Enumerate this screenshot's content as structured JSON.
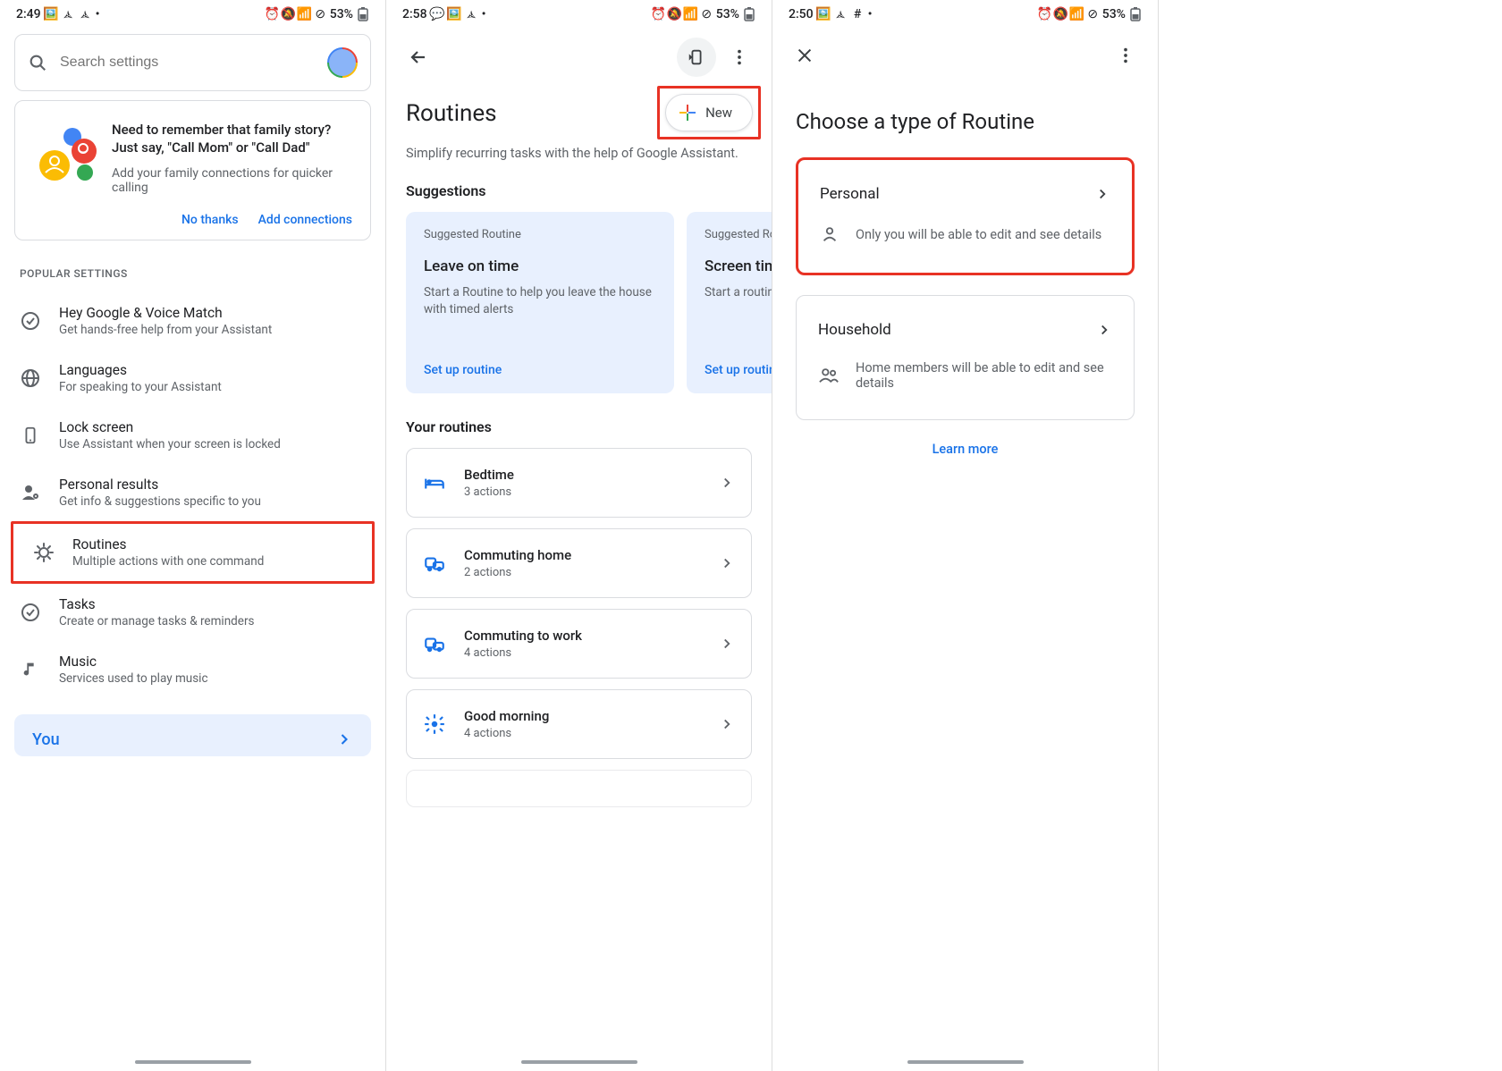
{
  "screen1": {
    "status": {
      "time": "2:49",
      "battery": "53%"
    },
    "search_placeholder": "Search settings",
    "promo": {
      "title": "Need to remember that family story? Just say, \"Call Mom\" or \"Call Dad\"",
      "sub": "Add your family connections for quicker calling",
      "no_thanks": "No thanks",
      "add": "Add connections"
    },
    "popular_label": "POPULAR SETTINGS",
    "items": [
      {
        "title": "Hey Google & Voice Match",
        "sub": "Get hands-free help from your Assistant"
      },
      {
        "title": "Languages",
        "sub": "For speaking to your Assistant"
      },
      {
        "title": "Lock screen",
        "sub": "Use Assistant when your screen is locked"
      },
      {
        "title": "Personal results",
        "sub": "Get info & suggestions specific to you"
      },
      {
        "title": "Routines",
        "sub": "Multiple actions with one command"
      },
      {
        "title": "Tasks",
        "sub": "Create or manage tasks & reminders"
      },
      {
        "title": "Music",
        "sub": "Services used to play music"
      }
    ],
    "you": "You"
  },
  "screen2": {
    "status": {
      "time": "2:58",
      "battery": "53%"
    },
    "title": "Routines",
    "new_label": "New",
    "subtitle": "Simplify recurring tasks with the help of Google Assistant.",
    "suggestions_label": "Suggestions",
    "suggest": [
      {
        "kicker": "Suggested Routine",
        "title": "Leave on time",
        "desc": "Start a Routine to help you leave the house with timed alerts",
        "cta": "Set up routine"
      },
      {
        "kicker": "Suggested Routine",
        "title": "Screen time",
        "desc": "Start a routine with timed ...",
        "cta": "Set up routine"
      }
    ],
    "your_label": "Your routines",
    "routines": [
      {
        "t": "Bedtime",
        "s": "3 actions"
      },
      {
        "t": "Commuting home",
        "s": "2 actions"
      },
      {
        "t": "Commuting to work",
        "s": "4 actions"
      },
      {
        "t": "Good morning",
        "s": "4 actions"
      }
    ]
  },
  "screen3": {
    "status": {
      "time": "2:50",
      "battery": "53%"
    },
    "title": "Choose a type of Routine",
    "personal": {
      "t": "Personal",
      "d": "Only you will be able to edit and see details"
    },
    "household": {
      "t": "Household",
      "d": "Home members will be able to edit and see details"
    },
    "learn_more": "Learn more"
  }
}
